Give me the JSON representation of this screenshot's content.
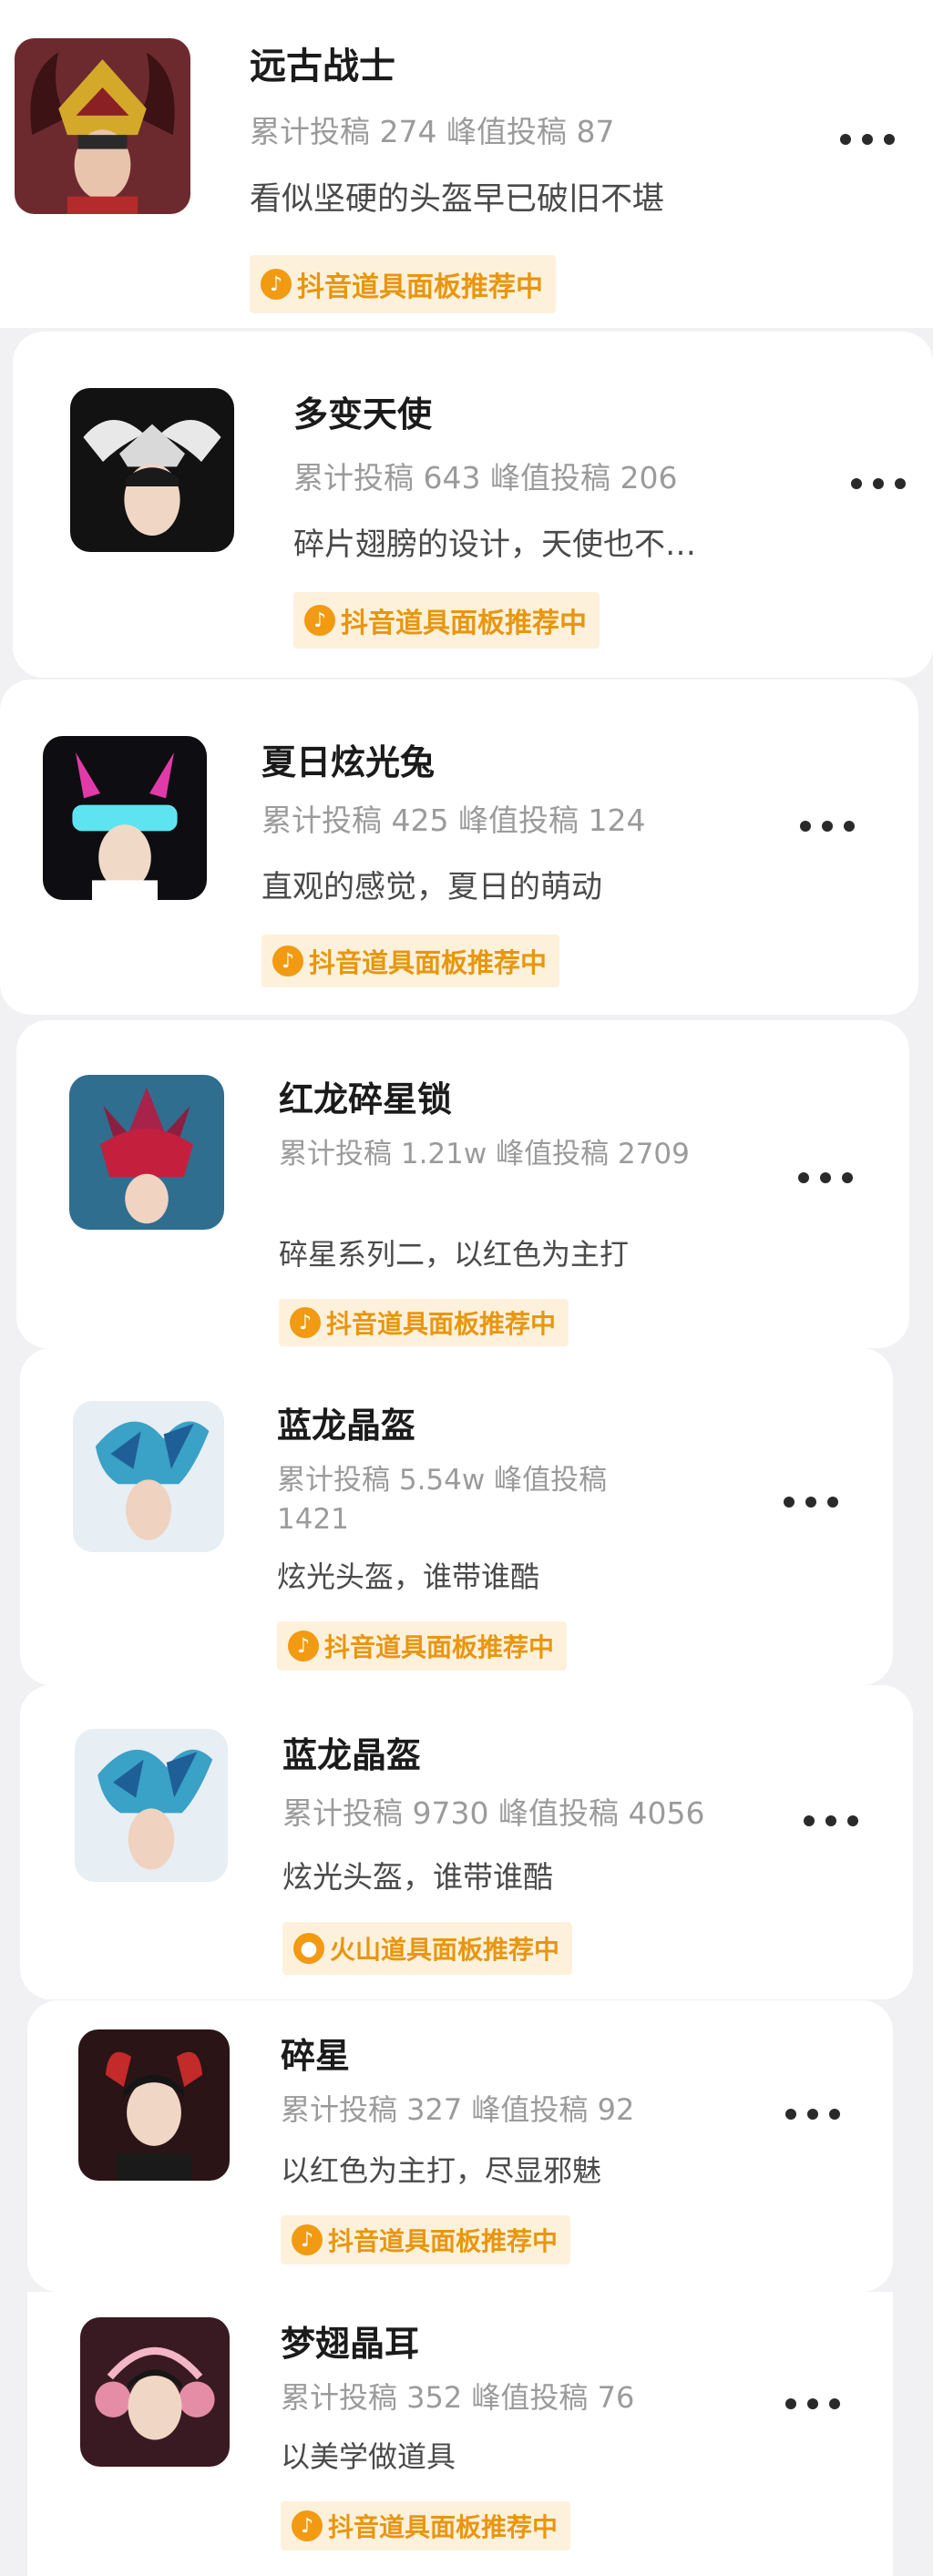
{
  "items": [
    {
      "title": "远古战士",
      "stats": "累计投稿 274  峰值投稿 87",
      "desc": "看似坚硬的头盔早已破旧不堪",
      "badge": "抖音道具面板推荐中",
      "badge_icon": "douyin-icon"
    },
    {
      "title": "多变天使",
      "stats": "累计投稿 643  峰值投稿 206",
      "desc": "碎片翅膀的设计，天使也不…",
      "badge": "抖音道具面板推荐中",
      "badge_icon": "douyin-icon"
    },
    {
      "title": "夏日炫光兔",
      "stats": "累计投稿 425  峰值投稿 124",
      "desc": "直观的感觉，夏日的萌动",
      "badge": "抖音道具面板推荐中",
      "badge_icon": "douyin-icon"
    },
    {
      "title": "红龙碎星锁",
      "stats": "累计投稿 1.21w  峰值投稿 2709",
      "desc": "碎星系列二，以红色为主打",
      "badge": "抖音道具面板推荐中",
      "badge_icon": "douyin-icon"
    },
    {
      "title": "蓝龙晶盔",
      "stats": "累计投稿 5.54w  峰值投稿 1421",
      "desc": "炫光头盔，谁带谁酷",
      "badge": "抖音道具面板推荐中",
      "badge_icon": "douyin-icon"
    },
    {
      "title": "蓝龙晶盔",
      "stats": "累计投稿 9730  峰值投稿 4056",
      "desc": "炫光头盔，谁带谁酷",
      "badge": "火山道具面板推荐中",
      "badge_icon": "huoshan-icon"
    },
    {
      "title": "碎星",
      "stats": "累计投稿 327  峰值投稿 92",
      "desc": "以红色为主打，尽显邪魅",
      "badge": "抖音道具面板推荐中",
      "badge_icon": "douyin-icon"
    },
    {
      "title": "梦翅晶耳",
      "stats": "累计投稿 352  峰值投稿 76",
      "desc": "以美学做道具",
      "badge": "抖音道具面板推荐中",
      "badge_icon": "douyin-icon"
    }
  ],
  "icon_glyphs": {
    "douyin": "♪",
    "huoshan": "●"
  },
  "colors": {
    "badge_text": "#e8960f",
    "badge_bg": "#fdf1dc",
    "background": "#f1f1f3"
  }
}
